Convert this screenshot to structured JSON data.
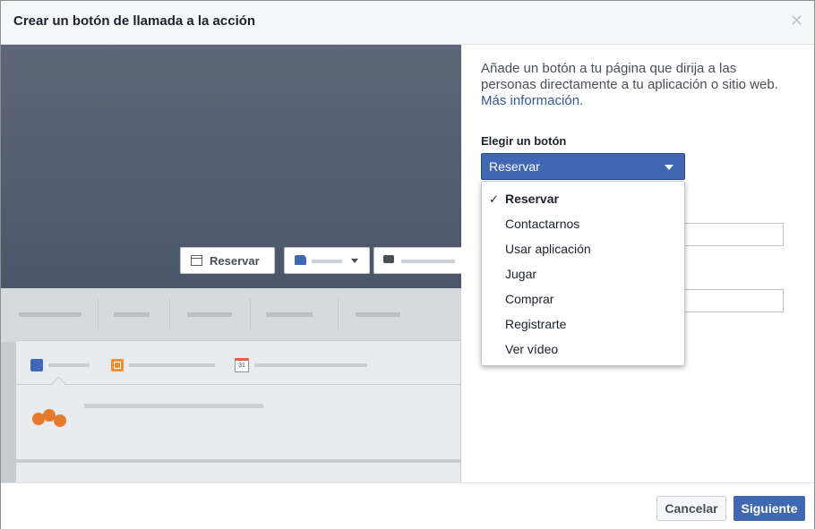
{
  "dialog": {
    "title": "Crear un botón de llamada a la acción",
    "close_icon": "close-icon"
  },
  "preview": {
    "cta_button_label": "Reservar"
  },
  "panel": {
    "description": "Añade un botón a tu página que dirija a las personas directamente a tu aplicación o sitio web.",
    "more_info_link": "Más información.",
    "choose_label": "Elegir un botón",
    "selected_value": "Reservar"
  },
  "dropdown": {
    "check_icon": "checkmark-icon",
    "check_glyph": "✓",
    "items": [
      {
        "label": "Reservar",
        "selected": true
      },
      {
        "label": "Contactarnos"
      },
      {
        "label": "Usar aplicación"
      },
      {
        "label": "Jugar"
      },
      {
        "label": "Comprar"
      },
      {
        "label": "Registrarte"
      },
      {
        "label": "Ver vídeo"
      }
    ]
  },
  "footer": {
    "cancel_label": "Cancelar",
    "next_label": "Siguiente"
  },
  "calendar_icon_text": "31",
  "colors": {
    "primary": "#4267b2",
    "link": "#365899",
    "cover": "#5d6778"
  }
}
